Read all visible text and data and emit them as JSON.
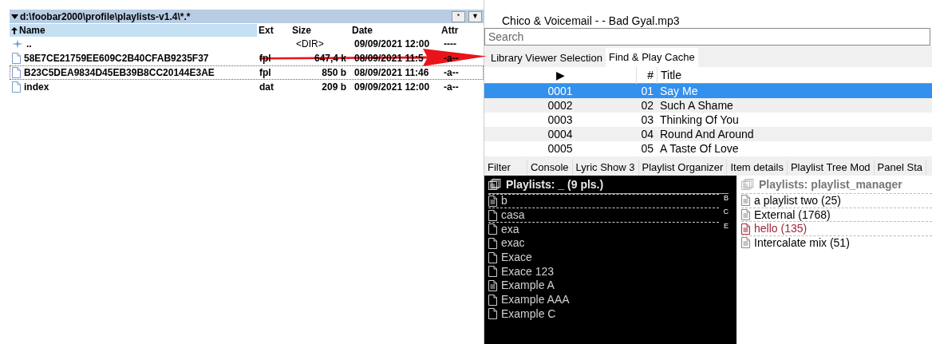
{
  "file_panel": {
    "path": "d:\\foobar2000\\profile\\playlists-v1.4\\*.*",
    "buttons": [
      "*",
      "▼"
    ],
    "columns": [
      "Name",
      "Ext",
      "Size",
      "Date",
      "Attr"
    ],
    "rows": [
      {
        "kind": "parent",
        "name": "..",
        "ext": "",
        "size": "<DIR>",
        "date": "09/09/2021 12:00",
        "attr": "----",
        "focused": false
      },
      {
        "kind": "file",
        "name": "58E7CE21759EE609C2B40CFAB9235F37",
        "ext": "fpl",
        "size": "647,4 k",
        "date": "08/09/2021 11:5",
        "attr": "-a--",
        "focused": false
      },
      {
        "kind": "file",
        "name": "B23C5DEA9834D45EB39B8CC20144E3AE",
        "ext": "fpl",
        "size": "850 b",
        "date": "08/09/2021 11:46",
        "attr": "-a--",
        "focused": true
      },
      {
        "kind": "file",
        "name": "index",
        "ext": "dat",
        "size": "209 b",
        "date": "09/09/2021 12:00",
        "attr": "-a--",
        "focused": false
      }
    ]
  },
  "now_playing": "Chico & Voicemail - - Bad Gyal.mp3",
  "search": {
    "placeholder": "Search"
  },
  "tabs": [
    {
      "label": "Library Viewer Selection",
      "selected": false
    },
    {
      "label": "Find & Play Cache",
      "selected": true
    }
  ],
  "track_table": {
    "columns": [
      "▶",
      "#",
      "Title"
    ],
    "rows": [
      {
        "index": "0001",
        "number": "01",
        "title": "Say Me",
        "selected": true
      },
      {
        "index": "0002",
        "number": "02",
        "title": "Such A Shame",
        "selected": false
      },
      {
        "index": "0003",
        "number": "03",
        "title": "Thinking Of You",
        "selected": false
      },
      {
        "index": "0004",
        "number": "04",
        "title": "Round And Around",
        "selected": false
      },
      {
        "index": "0005",
        "number": "05",
        "title": "A Taste Of Love",
        "selected": false
      }
    ]
  },
  "bottom_tabs": [
    {
      "label": "Filter",
      "selected": false
    },
    {
      "label": "Console",
      "selected": false
    },
    {
      "label": "Lyric Show 3",
      "selected": false
    },
    {
      "label": "Playlist Organizer",
      "selected": false
    },
    {
      "label": "Item details",
      "selected": false
    },
    {
      "label": "Playlist Tree Mod",
      "selected": false
    },
    {
      "label": "Panel Sta",
      "selected": false
    }
  ],
  "playlists_dark": {
    "title": "Playlists: _ (9 pls.)",
    "items": [
      {
        "name": "b",
        "kind": "lined",
        "letter": "B"
      },
      {
        "name": "casa",
        "kind": "empty",
        "letter": "C"
      },
      {
        "name": "exa",
        "kind": "empty",
        "letter": "E"
      },
      {
        "name": "exac",
        "kind": "empty"
      },
      {
        "name": "Exace",
        "kind": "empty"
      },
      {
        "name": "Exace 123",
        "kind": "empty"
      },
      {
        "name": "Example A",
        "kind": "lined"
      },
      {
        "name": "Example AAA",
        "kind": "empty"
      },
      {
        "name": "Example C",
        "kind": "empty"
      }
    ]
  },
  "playlists_light": {
    "title": "Playlists: playlist_manager",
    "items": [
      {
        "name": "a playlist two (25)",
        "color": "#000000"
      },
      {
        "name": "External (1768)",
        "color": "#000000"
      },
      {
        "name": "hello (135)",
        "color": "#a0283c"
      },
      {
        "name": "Intercalate mix (51)",
        "color": "#000000"
      }
    ]
  }
}
